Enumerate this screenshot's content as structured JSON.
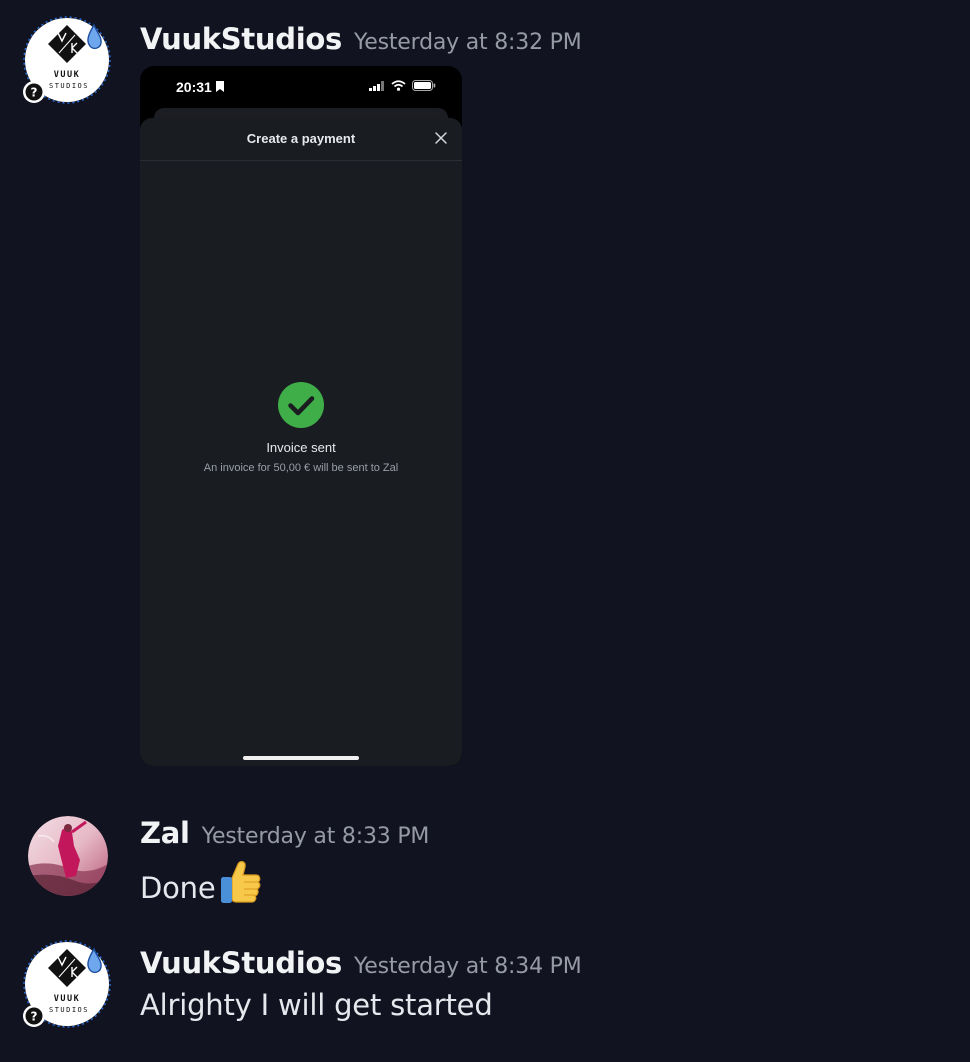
{
  "messages": [
    {
      "author": "VuukStudios",
      "timestamp": "Yesterday at 8:32 PM",
      "avatar_icon": "vuukstudios-logo-icon",
      "avatar_text": "VUUK STUDIOS",
      "attachment": {
        "status_time": "20:31",
        "sheet_title": "Create a payment",
        "success_title": "Invoice sent",
        "success_desc": "An invoice for 50,00 € will be sent to Zal"
      }
    },
    {
      "author": "Zal",
      "timestamp": "Yesterday at 8:33 PM",
      "avatar_icon": "zal-avatar-image",
      "text": "Done",
      "emoji": "thumbs-up-icon"
    },
    {
      "author": "VuukStudios",
      "timestamp": "Yesterday at 8:34 PM",
      "avatar_icon": "vuukstudios-logo-icon",
      "avatar_text": "VUUK STUDIOS",
      "text": "Alrighty I will get started"
    }
  ],
  "colors": {
    "background": "#121320",
    "username": "#f2f3f5",
    "timestamp": "#969aa4",
    "success_green": "#3fae49"
  }
}
